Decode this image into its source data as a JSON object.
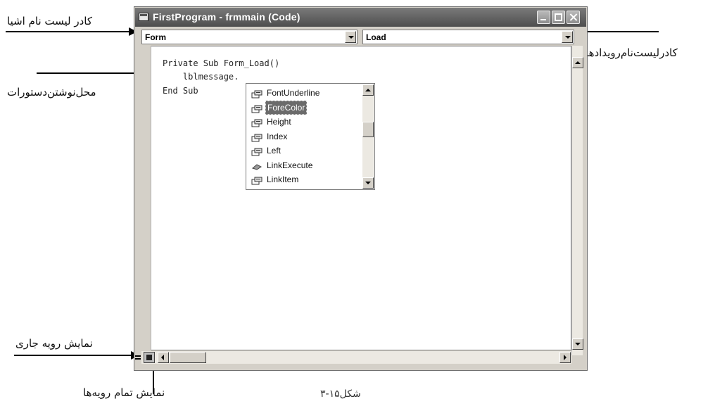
{
  "window": {
    "title": "FirstProgram - frmmain (Code)",
    "object_combo": "Form",
    "event_combo": "Load"
  },
  "code": {
    "line1": "Private Sub Form_Load()",
    "line2": "    lblmessage.",
    "line3": "End Sub"
  },
  "autocomplete": {
    "items": [
      {
        "label": "FontUnderline",
        "icon": "property-icon"
      },
      {
        "label": "ForeColor",
        "icon": "property-icon",
        "selected": true
      },
      {
        "label": "Height",
        "icon": "property-icon"
      },
      {
        "label": "Index",
        "icon": "property-icon"
      },
      {
        "label": "Left",
        "icon": "property-icon"
      },
      {
        "label": "LinkExecute",
        "icon": "method-icon"
      },
      {
        "label": "LinkItem",
        "icon": "property-icon"
      }
    ]
  },
  "annotations": {
    "object_list": "کادر لیست نام اشیا",
    "event_list": "کادرلیست‌نام‌رویدادها",
    "code_area": "محل‌نوشتن‌دستورات",
    "current_procedure": "نمایش رویه جاری",
    "all_procedures": "نمایش تمام رویه‌ها"
  },
  "caption": "شکل۱۵-۳",
  "colors": {
    "title_bar": "#5e5e5e",
    "selection": "#6b6b6b"
  }
}
